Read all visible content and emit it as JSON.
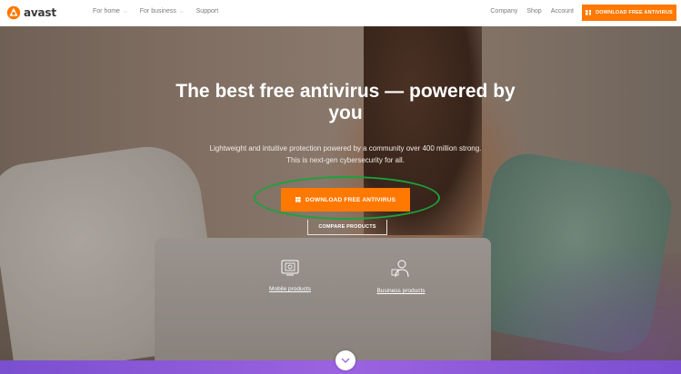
{
  "brand": {
    "name": "avast",
    "logo_color": "#ff7800"
  },
  "nav": {
    "left_items": [
      {
        "label": "For home",
        "has_dropdown": true
      },
      {
        "label": "For business",
        "has_dropdown": true
      },
      {
        "label": "Support",
        "has_dropdown": false
      }
    ],
    "right_items": [
      "Company",
      "Shop",
      "Account"
    ],
    "download_label": "DOWNLOAD FREE ANTIVIRUS"
  },
  "hero": {
    "headline": "The best free antivirus — powered by you",
    "subline_1": "Lightweight and intuitive protection powered by a community over 400 million strong.",
    "subline_2": "This is next-gen cybersecurity for all.",
    "cta_label": "DOWNLOAD FREE ANTIVIRUS",
    "compare_label": "COMPARE PRODUCTS",
    "products": [
      {
        "label": "Mobile products",
        "icon": "mobile-devices-icon"
      },
      {
        "label": "Business products",
        "icon": "business-user-icon"
      }
    ]
  },
  "colors": {
    "accent": "#ff7800",
    "highlight_ring": "#1aa33b",
    "bottom_bar": "#8a5ad8"
  }
}
